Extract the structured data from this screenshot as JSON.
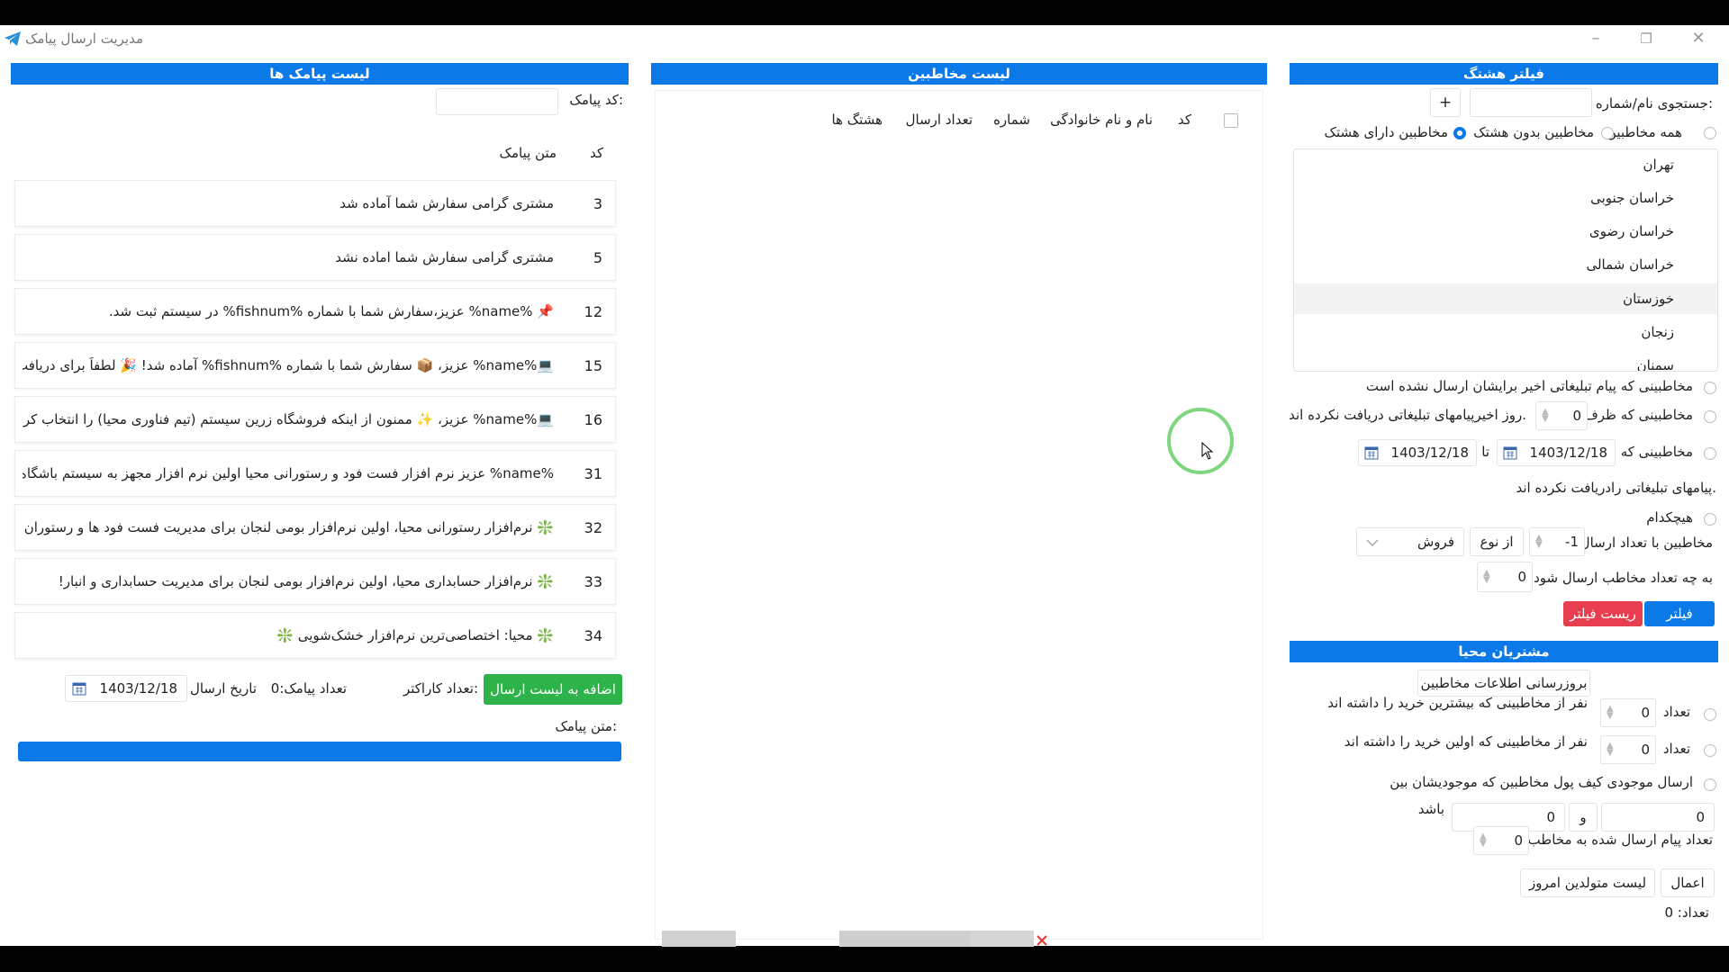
{
  "window": {
    "title": "مدیریت ارسال پیامک"
  },
  "panels": {
    "sms": {
      "header": "لیست پیامک ها"
    },
    "contacts": {
      "header": "لیست مخاطبین"
    },
    "filter": {
      "header": "فیلتر هشتگ"
    },
    "customers": {
      "header": "مشتریان محیا"
    }
  },
  "sms_panel": {
    "code_label": "کد پیامک:",
    "col_code": "کد",
    "col_text": "متن پیامک",
    "rows": [
      {
        "code": "3",
        "text": "مشتری گرامی سفارش شما آماده شد"
      },
      {
        "code": "5",
        "text": "مشتری گرامی سفارش شما اماده نشد"
      },
      {
        "code": "12",
        "text": "📌 %name% عزیز،سفارش شما با شماره %fishnum% در سیستم ثبت شد."
      },
      {
        "code": "15",
        "text": "💻%name% عزیز، 📦 سفارش شما با شماره %fishnum% آماده شد! 🎉 لطفاً برای دریافت سفار..."
      },
      {
        "code": "16",
        "text": "💻%name% عزیز، ✨ ممنون از اینکه فروشگاه زرین سیستم (تیم فناوری محیا) را انتخاب کردید!..."
      },
      {
        "code": "31",
        "text": "%name% عزیز نرم افزار فست فود و رستورانی محیا اولین نرم افزار مجهز به سیستم باشگاه مشتریا..."
      },
      {
        "code": "32",
        "text": "❇️ نرم‌افزار رستورانی محیا، اولین نرم‌افزار بومی لنجان برای مدیریت فست فود ها و رستوران ها!"
      },
      {
        "code": "33",
        "text": "❇️ نرم‌افزار حسابداری محیا، اولین نرم‌افزار بومی لنجان برای مدیریت حسابداری و انبار!"
      },
      {
        "code": "34",
        "text": "❇️ محیا: اختصاصی‌ترین نرم‌افزار خشک‌شویی ❇️"
      }
    ],
    "add_button": "اضافه به لیست ارسال",
    "char_count_label": "تعداد کاراکتر:",
    "sms_count_label": "تعداد پیامک:0",
    "send_date_label": "تاریخ ارسال",
    "send_date": "1403/12/18",
    "sms_text_label": "متن پیامک:"
  },
  "contacts_panel": {
    "columns": [
      "کد",
      "نام و نام خانوادگی",
      "شماره",
      "تعداد ارسال",
      "هشتگ ها"
    ]
  },
  "filter_panel": {
    "search_label": "جستجوی نام/شماره:",
    "add_label": "+",
    "radio_all": "همه مخاطبین",
    "radio_none": "مخاطبین بدون هشتک",
    "radio_with": "مخاطبین دارای هشتک",
    "provinces": [
      "تهران",
      "خراسان جنوبی",
      "خراسان رضوی",
      "خراسان شمالی",
      "خوزستان",
      "زنجان",
      "سمنان"
    ],
    "opt1": "مخاطبینی که پیام تبلیغاتی اخیر برایشان ارسال نشده است",
    "opt2_a": "مخاطبینی که ظرف",
    "opt2_val": "0",
    "opt2_b": "روز اخیرپیامهای تبلیغاتی دریافت نکرده اند.",
    "opt3_a": "مخاطبینی که از",
    "date_from": "1403/12/18",
    "to_label": "تا",
    "date_to": "1403/12/18",
    "opt3_b": "پیامهای تبلیغاتی رادریافت نکرده اند.",
    "opt4": "هیچکدام",
    "count_label": "مخاطبین با تعداد ارسال",
    "count_val": "-1",
    "type_label": "از نوع",
    "type_val": "فروش",
    "send_to_label": "به چه تعداد مخاطب ارسال شود",
    "send_to_val": "0",
    "filter_button": "فیلتر",
    "reset_button": "ریست فیلتر"
  },
  "customers_panel": {
    "update_button": "بروزرسانی اطلاعات مخاطبین",
    "top_count_label": "تعداد",
    "top_val": "0",
    "top_text": "نفر از مخاطبینی که بیشترین خرید را داشته اند",
    "first_count_label": "تعداد",
    "first_val": "0",
    "first_text": "نفر از مخاطبینی که اولین خرید را داشته اند",
    "wallet_text": "ارسال موجودی کیف پول مخاطبین که موجودیشان بین",
    "wallet_min": "0",
    "and_label": "و",
    "wallet_max": "0",
    "be_label": "باشد",
    "sent_count_label": "تعداد پیام ارسال شده به مخاطب",
    "sent_count_val": "0",
    "apply_button": "اعمال",
    "birthday_button": "لیست متولدین امروز",
    "total_label": "تعداد: 0"
  },
  "colors": {
    "accent": "#0b79e8",
    "danger": "#e63e4e",
    "success": "#2db34a"
  }
}
